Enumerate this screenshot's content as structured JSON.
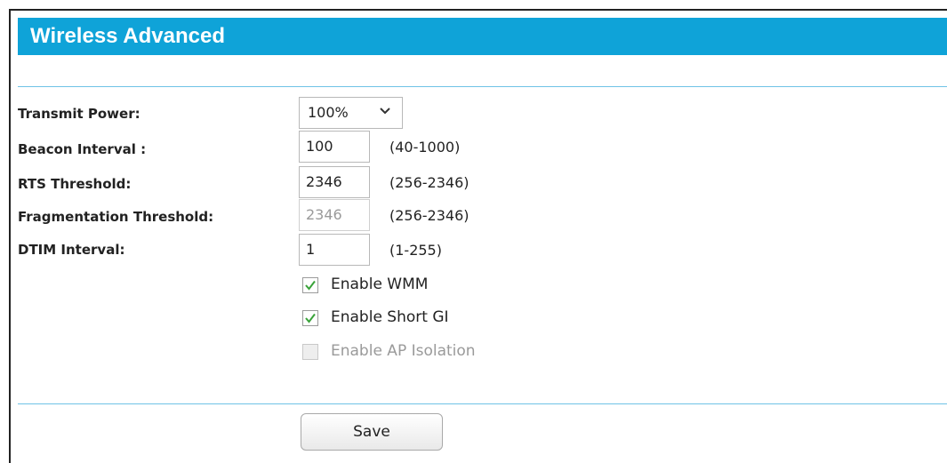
{
  "header": {
    "title": "Wireless Advanced"
  },
  "fields": {
    "transmit_power": {
      "label": "Transmit Power:",
      "value": "100%"
    },
    "beacon_interval": {
      "label": "Beacon Interval :",
      "value": "100",
      "range": "(40-1000)"
    },
    "rts_threshold": {
      "label": "RTS Threshold:",
      "value": "2346",
      "range": "(256-2346)"
    },
    "fragmentation_threshold": {
      "label": "Fragmentation Threshold:",
      "value": "2346",
      "range": "(256-2346)",
      "disabled": true
    },
    "dtim_interval": {
      "label": "DTIM Interval:",
      "value": "1",
      "range": "(1-255)"
    }
  },
  "options": {
    "wmm": {
      "label": "Enable WMM",
      "checked": true
    },
    "short_gi": {
      "label": "Enable Short GI",
      "checked": true
    },
    "ap_isolation": {
      "label": "Enable AP Isolation",
      "checked": false,
      "disabled": true
    }
  },
  "actions": {
    "save_label": "Save"
  },
  "colors": {
    "header_bg": "#0fa3d8",
    "rule": "#6fc3e6",
    "check_green": "#3aa33a"
  }
}
